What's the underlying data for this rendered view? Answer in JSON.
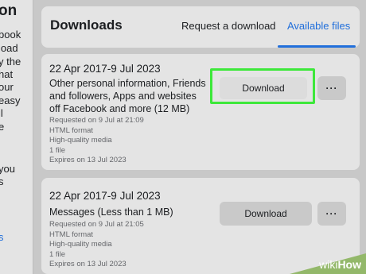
{
  "sidebar": {
    "title_fragment": "on",
    "lines": [
      "book",
      "load",
      "y the",
      "hat",
      "our",
      "easy",
      "il",
      "e",
      "you",
      "s"
    ],
    "link_fragment": "s"
  },
  "header": {
    "title": "Downloads",
    "tabs": [
      {
        "label": "Request a download",
        "active": false
      },
      {
        "label": "Available files",
        "active": true
      }
    ]
  },
  "files": [
    {
      "date_range": "22 Apr 2017-9 Jul 2023",
      "description": "Other personal information, Friends and followers, Apps and websites off Facebook and more (12 MB)",
      "requested": "Requested on 9 Jul at 21:09",
      "format": "HTML format",
      "quality": "High-quality media",
      "count": "1 file",
      "expires": "Expires on 13 Jul 2023",
      "download_label": "Download",
      "more_label": "···",
      "highlighted": true
    },
    {
      "date_range": "22 Apr 2017-9 Jul 2023",
      "description": "Messages (Less than 1 MB)",
      "requested": "Requested on 9 Jul at 21:05",
      "format": "HTML format",
      "quality": "High-quality media",
      "count": "1 file",
      "expires": "Expires on 13 Jul 2023",
      "download_label": "Download",
      "more_label": "···",
      "highlighted": false
    }
  ],
  "watermark": {
    "prefix": "wiki",
    "suffix": "How"
  },
  "colors": {
    "accent": "#216fdb",
    "highlight": "#3de83a",
    "watermark": "#93b86a"
  }
}
